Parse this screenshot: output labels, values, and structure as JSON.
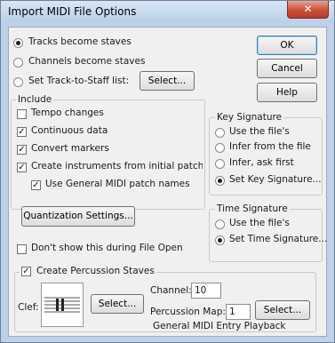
{
  "window": {
    "title": "Import MIDI File Options",
    "close_glyph": "✕"
  },
  "buttons": {
    "ok": "OK",
    "cancel": "Cancel",
    "help": "Help"
  },
  "staff_mode": {
    "options": [
      "Tracks become staves",
      "Channels become staves",
      "Set Track-to-Staff list:"
    ],
    "selected": 0,
    "select_button": "Select..."
  },
  "include": {
    "title": "Include",
    "items": [
      {
        "label": "Tempo changes",
        "checked": false
      },
      {
        "label": "Continuous data",
        "checked": true
      },
      {
        "label": "Convert markers",
        "checked": true
      },
      {
        "label": "Create instruments from initial patches",
        "checked": true
      },
      {
        "label": "Use General MIDI patch names",
        "checked": true
      }
    ]
  },
  "key_signature": {
    "title": "Key Signature",
    "options": [
      "Use the file's",
      "Infer from the file",
      "Infer, ask first",
      "Set Key Signature..."
    ],
    "selected": 3
  },
  "time_signature": {
    "title": "Time Signature",
    "options": [
      "Use the file's",
      "Set Time Signature..."
    ],
    "selected": 1
  },
  "quantization_button": "Quantization Settings...",
  "dont_show": {
    "label": "Don't show this during File Open",
    "checked": false
  },
  "percussion": {
    "title": "Create Percussion Staves",
    "checked": true,
    "clef_label": "Clef:",
    "select_button": "Select...",
    "channel_label": "Channel:",
    "channel_value": "10",
    "map_label": "Percussion Map:",
    "map_value": "1",
    "map_select_button": "Select...",
    "map_name": "General MIDI Entry Playback"
  },
  "check_mark": "✓"
}
